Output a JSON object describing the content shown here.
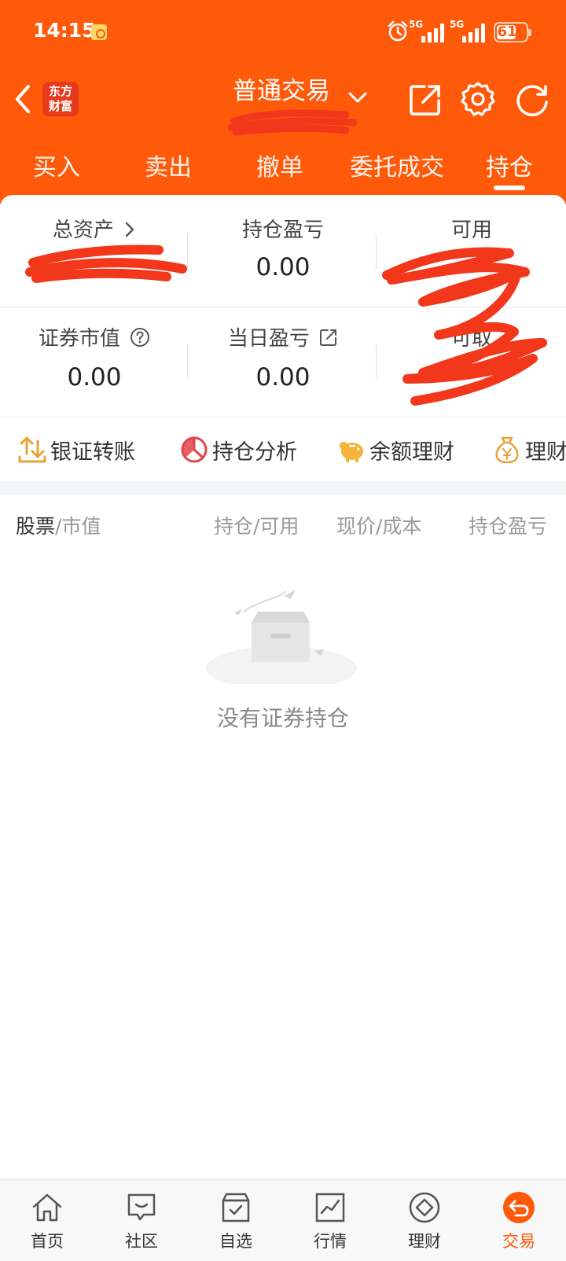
{
  "status_bar": {
    "time": "14:15",
    "network_1": "5G",
    "network_2": "5G",
    "battery": "61"
  },
  "header": {
    "logo_text_1": "东方",
    "logo_text_2": "财富",
    "title": "普通交易"
  },
  "tabs": [
    {
      "label": "买入"
    },
    {
      "label": "卖出"
    },
    {
      "label": "撤单"
    },
    {
      "label": "委托成交"
    },
    {
      "label": "持仓"
    }
  ],
  "summary": {
    "total_assets_label": "总资产",
    "position_pnl_label": "持仓盈亏",
    "position_pnl_value": "0.00",
    "available_label": "可用",
    "securities_value_label": "证券市值",
    "securities_value_value": "0.00",
    "daily_pnl_label": "当日盈亏",
    "daily_pnl_value": "0.00",
    "withdrawable_label": "可取"
  },
  "quick_actions": [
    {
      "label": "银证转账",
      "icon": "transfer-icon"
    },
    {
      "label": "持仓分析",
      "icon": "pie-chart-icon"
    },
    {
      "label": "余额理财",
      "icon": "piggy-bank-icon"
    },
    {
      "label": "理财",
      "icon": "money-bag-icon"
    }
  ],
  "list_header": {
    "stock": "股票",
    "market_value": "/市值",
    "holding": "持仓/可用",
    "price": "现价/成本",
    "pnl": "持仓盈亏"
  },
  "empty_state": {
    "text": "没有证券持仓"
  },
  "bottom_nav": [
    {
      "label": "首页",
      "icon": "home-icon"
    },
    {
      "label": "社区",
      "icon": "community-icon"
    },
    {
      "label": "自选",
      "icon": "watchlist-icon"
    },
    {
      "label": "行情",
      "icon": "market-icon"
    },
    {
      "label": "理财",
      "icon": "wealth-icon"
    },
    {
      "label": "交易",
      "icon": "trade-icon"
    }
  ],
  "colors": {
    "brand": "#ff5a0a",
    "redaction": "#f2371b"
  }
}
